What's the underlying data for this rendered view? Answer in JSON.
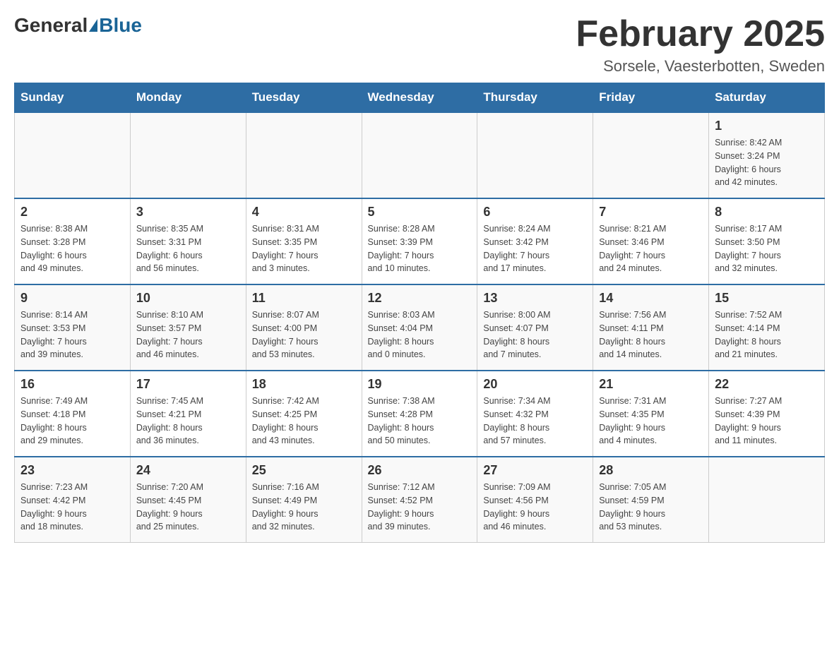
{
  "header": {
    "logo_general": "General",
    "logo_blue": "Blue",
    "month_title": "February 2025",
    "location": "Sorsele, Vaesterbotten, Sweden"
  },
  "weekdays": [
    "Sunday",
    "Monday",
    "Tuesday",
    "Wednesday",
    "Thursday",
    "Friday",
    "Saturday"
  ],
  "weeks": [
    [
      {
        "day": "",
        "info": ""
      },
      {
        "day": "",
        "info": ""
      },
      {
        "day": "",
        "info": ""
      },
      {
        "day": "",
        "info": ""
      },
      {
        "day": "",
        "info": ""
      },
      {
        "day": "",
        "info": ""
      },
      {
        "day": "1",
        "info": "Sunrise: 8:42 AM\nSunset: 3:24 PM\nDaylight: 6 hours\nand 42 minutes."
      }
    ],
    [
      {
        "day": "2",
        "info": "Sunrise: 8:38 AM\nSunset: 3:28 PM\nDaylight: 6 hours\nand 49 minutes."
      },
      {
        "day": "3",
        "info": "Sunrise: 8:35 AM\nSunset: 3:31 PM\nDaylight: 6 hours\nand 56 minutes."
      },
      {
        "day": "4",
        "info": "Sunrise: 8:31 AM\nSunset: 3:35 PM\nDaylight: 7 hours\nand 3 minutes."
      },
      {
        "day": "5",
        "info": "Sunrise: 8:28 AM\nSunset: 3:39 PM\nDaylight: 7 hours\nand 10 minutes."
      },
      {
        "day": "6",
        "info": "Sunrise: 8:24 AM\nSunset: 3:42 PM\nDaylight: 7 hours\nand 17 minutes."
      },
      {
        "day": "7",
        "info": "Sunrise: 8:21 AM\nSunset: 3:46 PM\nDaylight: 7 hours\nand 24 minutes."
      },
      {
        "day": "8",
        "info": "Sunrise: 8:17 AM\nSunset: 3:50 PM\nDaylight: 7 hours\nand 32 minutes."
      }
    ],
    [
      {
        "day": "9",
        "info": "Sunrise: 8:14 AM\nSunset: 3:53 PM\nDaylight: 7 hours\nand 39 minutes."
      },
      {
        "day": "10",
        "info": "Sunrise: 8:10 AM\nSunset: 3:57 PM\nDaylight: 7 hours\nand 46 minutes."
      },
      {
        "day": "11",
        "info": "Sunrise: 8:07 AM\nSunset: 4:00 PM\nDaylight: 7 hours\nand 53 minutes."
      },
      {
        "day": "12",
        "info": "Sunrise: 8:03 AM\nSunset: 4:04 PM\nDaylight: 8 hours\nand 0 minutes."
      },
      {
        "day": "13",
        "info": "Sunrise: 8:00 AM\nSunset: 4:07 PM\nDaylight: 8 hours\nand 7 minutes."
      },
      {
        "day": "14",
        "info": "Sunrise: 7:56 AM\nSunset: 4:11 PM\nDaylight: 8 hours\nand 14 minutes."
      },
      {
        "day": "15",
        "info": "Sunrise: 7:52 AM\nSunset: 4:14 PM\nDaylight: 8 hours\nand 21 minutes."
      }
    ],
    [
      {
        "day": "16",
        "info": "Sunrise: 7:49 AM\nSunset: 4:18 PM\nDaylight: 8 hours\nand 29 minutes."
      },
      {
        "day": "17",
        "info": "Sunrise: 7:45 AM\nSunset: 4:21 PM\nDaylight: 8 hours\nand 36 minutes."
      },
      {
        "day": "18",
        "info": "Sunrise: 7:42 AM\nSunset: 4:25 PM\nDaylight: 8 hours\nand 43 minutes."
      },
      {
        "day": "19",
        "info": "Sunrise: 7:38 AM\nSunset: 4:28 PM\nDaylight: 8 hours\nand 50 minutes."
      },
      {
        "day": "20",
        "info": "Sunrise: 7:34 AM\nSunset: 4:32 PM\nDaylight: 8 hours\nand 57 minutes."
      },
      {
        "day": "21",
        "info": "Sunrise: 7:31 AM\nSunset: 4:35 PM\nDaylight: 9 hours\nand 4 minutes."
      },
      {
        "day": "22",
        "info": "Sunrise: 7:27 AM\nSunset: 4:39 PM\nDaylight: 9 hours\nand 11 minutes."
      }
    ],
    [
      {
        "day": "23",
        "info": "Sunrise: 7:23 AM\nSunset: 4:42 PM\nDaylight: 9 hours\nand 18 minutes."
      },
      {
        "day": "24",
        "info": "Sunrise: 7:20 AM\nSunset: 4:45 PM\nDaylight: 9 hours\nand 25 minutes."
      },
      {
        "day": "25",
        "info": "Sunrise: 7:16 AM\nSunset: 4:49 PM\nDaylight: 9 hours\nand 32 minutes."
      },
      {
        "day": "26",
        "info": "Sunrise: 7:12 AM\nSunset: 4:52 PM\nDaylight: 9 hours\nand 39 minutes."
      },
      {
        "day": "27",
        "info": "Sunrise: 7:09 AM\nSunset: 4:56 PM\nDaylight: 9 hours\nand 46 minutes."
      },
      {
        "day": "28",
        "info": "Sunrise: 7:05 AM\nSunset: 4:59 PM\nDaylight: 9 hours\nand 53 minutes."
      },
      {
        "day": "",
        "info": ""
      }
    ]
  ]
}
